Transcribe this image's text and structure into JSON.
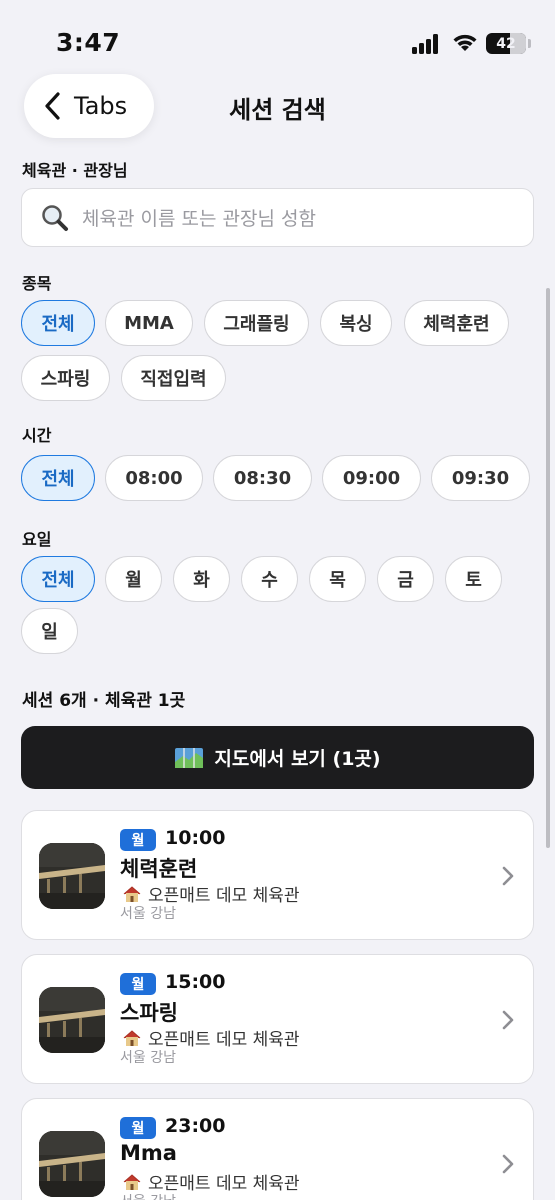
{
  "status_bar": {
    "time": "3:47",
    "battery": "42"
  },
  "nav": {
    "back_label": "Tabs",
    "title": "세션 검색"
  },
  "search": {
    "section_label": "체육관 · 관장님",
    "placeholder": "체육관 이름 또는 관장님 성함"
  },
  "sport": {
    "section_label": "종목",
    "chips": [
      "전체",
      "MMA",
      "그래플링",
      "복싱",
      "체력훈련",
      "스파링",
      "직접입력"
    ],
    "selected": "전체"
  },
  "time_filter": {
    "section_label": "시간",
    "chips": [
      "전체",
      "08:00",
      "08:30",
      "09:00",
      "09:30"
    ],
    "selected": "전체"
  },
  "day_filter": {
    "section_label": "요일",
    "chips": [
      "전체",
      "월",
      "화",
      "수",
      "목",
      "금",
      "토",
      "일"
    ],
    "selected": "전체"
  },
  "summary": "세션 6개 · 체육관 1곳",
  "map_button": {
    "icon": "map-icon",
    "label": "지도에서 보기 (1곳)"
  },
  "sessions": [
    {
      "day": "월",
      "time": "10:00",
      "title": "체력훈련",
      "gym": "오픈매트 데모 체육관",
      "region": "서울 강남"
    },
    {
      "day": "월",
      "time": "15:00",
      "title": "스파링",
      "gym": "오픈매트 데모 체육관",
      "region": "서울 강남"
    },
    {
      "day": "월",
      "time": "23:00",
      "title": "Mma",
      "gym": "오픈매트 데모 체육관",
      "region": "서울 강남"
    }
  ],
  "colors": {
    "accent": "#1f7ae0",
    "badge": "#1f6fd9",
    "dark_button": "#1c1c1e",
    "background": "#f2f2f7"
  }
}
